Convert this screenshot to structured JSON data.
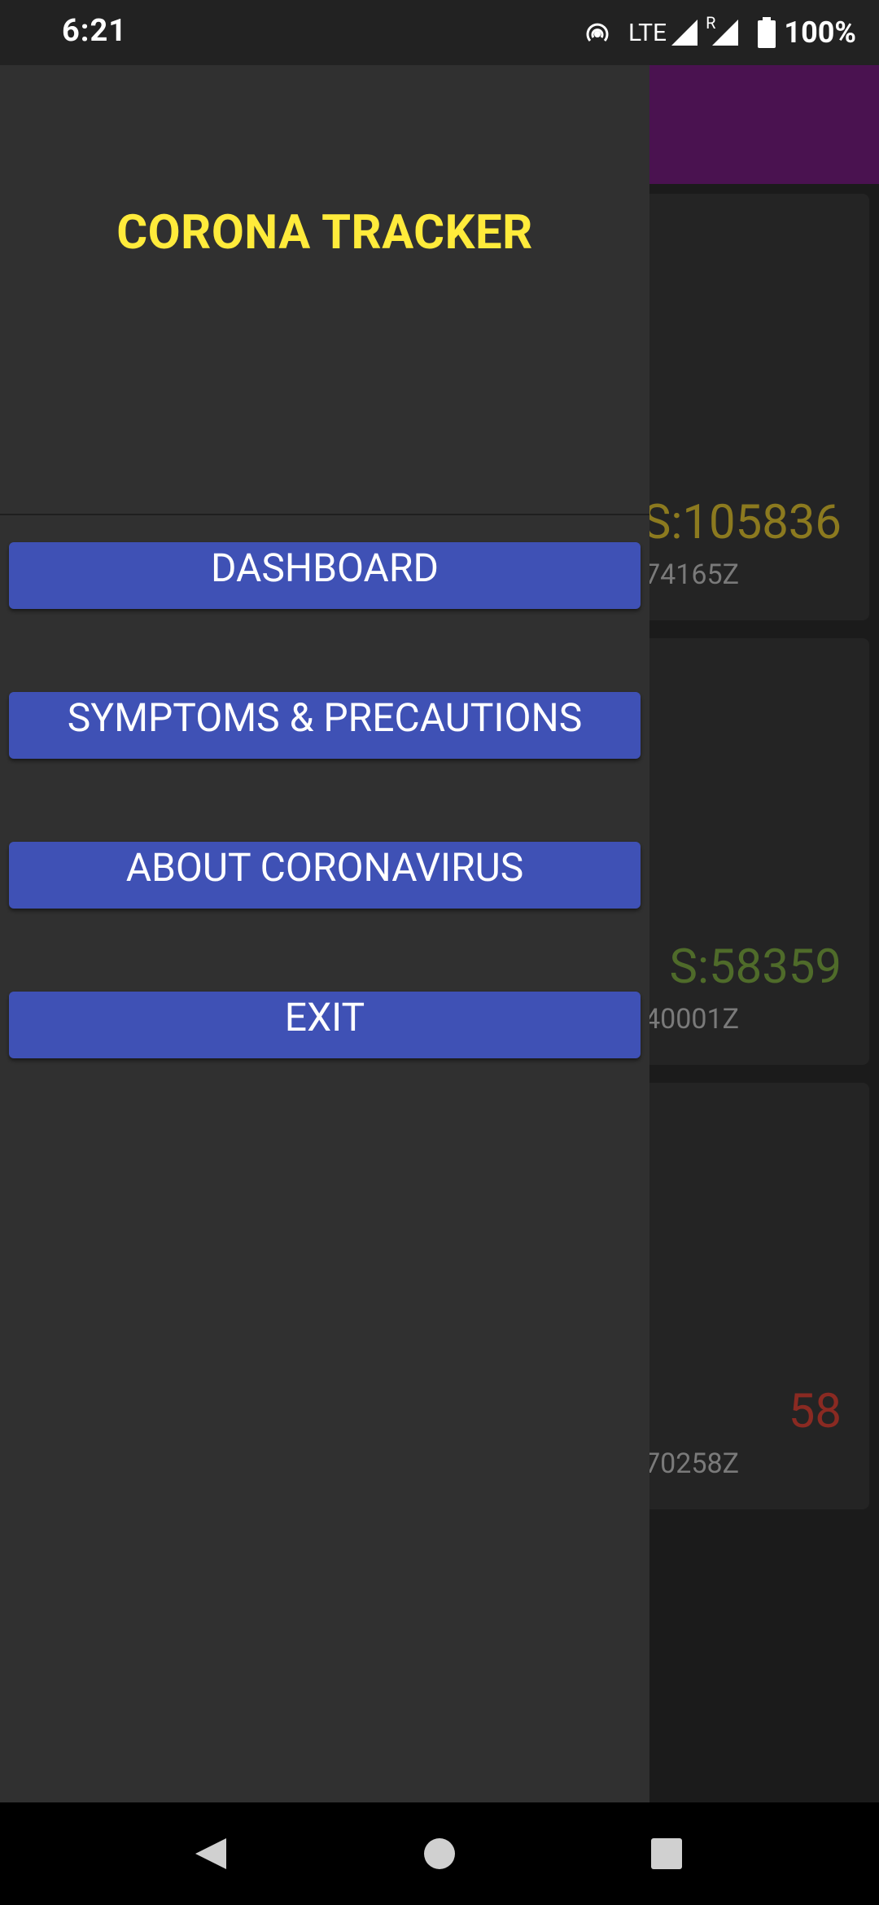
{
  "status_bar": {
    "time": "6:21",
    "network": "LTE",
    "roaming": "R",
    "battery": "100%",
    "icons": [
      "hotspot-icon",
      "signal-icon",
      "signal-roaming-icon",
      "battery-icon"
    ]
  },
  "background": {
    "app_bar_color": "#4a1250",
    "cards": [
      {
        "value": "S:105836",
        "time": "74165Z",
        "color": "#8c7a1f"
      },
      {
        "value": "S:58359",
        "time": "40001Z",
        "color": "#4f6b2a"
      },
      {
        "value": "58",
        "time": "70258Z",
        "color": "#8a2a22"
      }
    ]
  },
  "drawer": {
    "title": "CORONA TRACKER",
    "items": [
      {
        "label": "DASHBOARD"
      },
      {
        "label": "SYMPTOMS & PRECAUTIONS"
      },
      {
        "label": "ABOUT CORONAVIRUS"
      },
      {
        "label": "EXIT"
      }
    ]
  },
  "nav_bar": {
    "icons": [
      "back-icon",
      "home-icon",
      "recents-icon"
    ]
  },
  "colors": {
    "title": "#ffeb3b",
    "button": "#3f51b5",
    "drawer_bg": "#303030"
  }
}
